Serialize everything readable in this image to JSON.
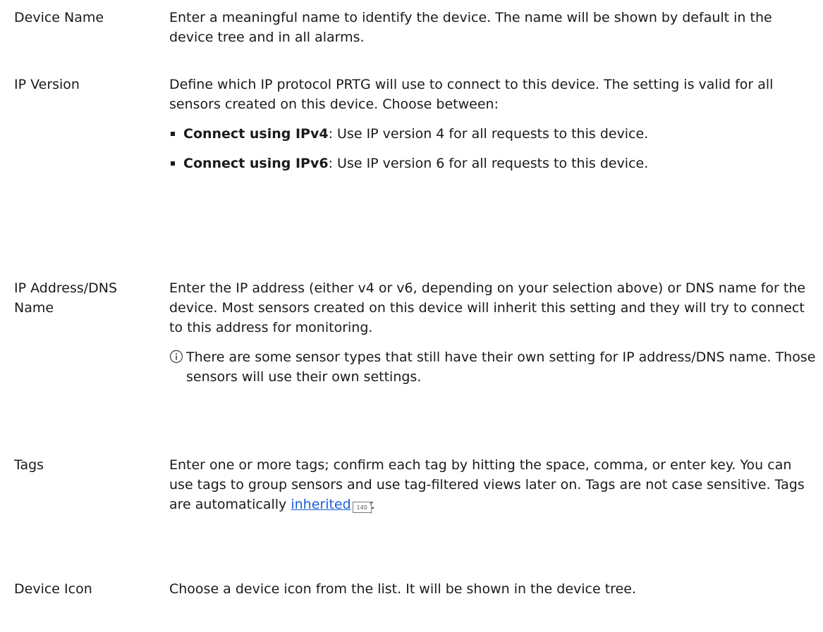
{
  "settings": [
    {
      "label": "Device Name",
      "description": "Enter a meaningful name to identify the device. The name will be shown by default in the device tree and in all alarms."
    },
    {
      "label": "IP Version",
      "description": "Define which IP protocol PRTG will use to connect to this device. The setting is valid for all sensors created on this device. Choose between:",
      "options": [
        {
          "name": "Connect using IPv4",
          "text": ": Use IP version 4 for all requests to this device."
        },
        {
          "name": "Connect using IPv6",
          "text": ": Use IP version 6 for all requests to this device."
        }
      ]
    },
    {
      "label": "IP Address/DNS Name",
      "description": "Enter the IP address (either v4 or v6, depending on your selection above) or DNS name for the device. Most sensors created on this device will inherit this setting and they will try to connect to this address for monitoring.",
      "note": "There are some sensor types that still have their own setting for IP address/DNS name. Those sensors will use their own settings."
    },
    {
      "label": "Tags",
      "description_before_link": "Enter one or more tags; confirm each tag by hitting the space, comma, or enter key. You can use tags to group sensors and use tag-filtered views later on. Tags are not case sensitive. Tags are automatically ",
      "link_text": "inherited",
      "page_ref": "140",
      "description_after_link": "."
    },
    {
      "label": "Device Icon",
      "description": "Choose a device icon from the list. It will be shown in the device tree."
    }
  ],
  "icons": {
    "note": "info-icon",
    "page_ref": "page-reference-icon"
  }
}
